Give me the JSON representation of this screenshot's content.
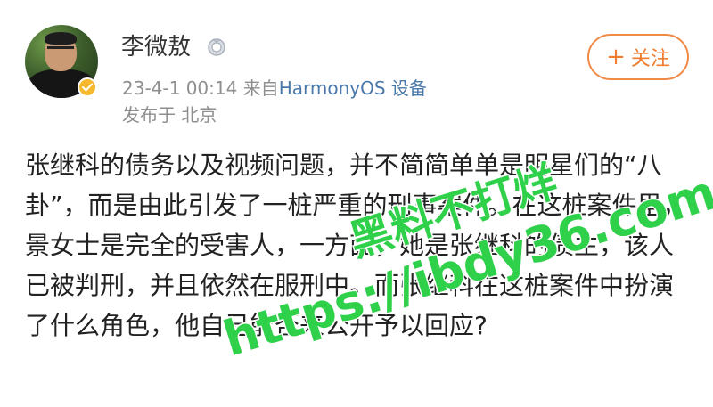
{
  "post": {
    "author": {
      "name": "李微敖",
      "level_icon": "medal-icon",
      "verified_icon": "verified-badge-icon"
    },
    "timestamp": "23-4-1 00:14",
    "source_prefix": "来自",
    "source_device": "HarmonyOS 设备",
    "location": "发布于 北京",
    "follow_button": {
      "label": "关注",
      "icon": "plus-icon"
    },
    "content": "张继科的债务以及视频问题，并不简简单单是明星们的“八卦”，而是由此引发了一桩严重的刑事案件。在这桩案件里，景女士是完全的受害人，一方面，她是张继科的债主，该人已被判刑，并且依然在服刑中。而张继科在这桩案件中扮演了什么角色，他自己能否来公开予以回应?"
  },
  "watermark": {
    "line1": "黑料不打烊",
    "line2": "https://ibdy36.com",
    "color": "#2fd14a"
  }
}
